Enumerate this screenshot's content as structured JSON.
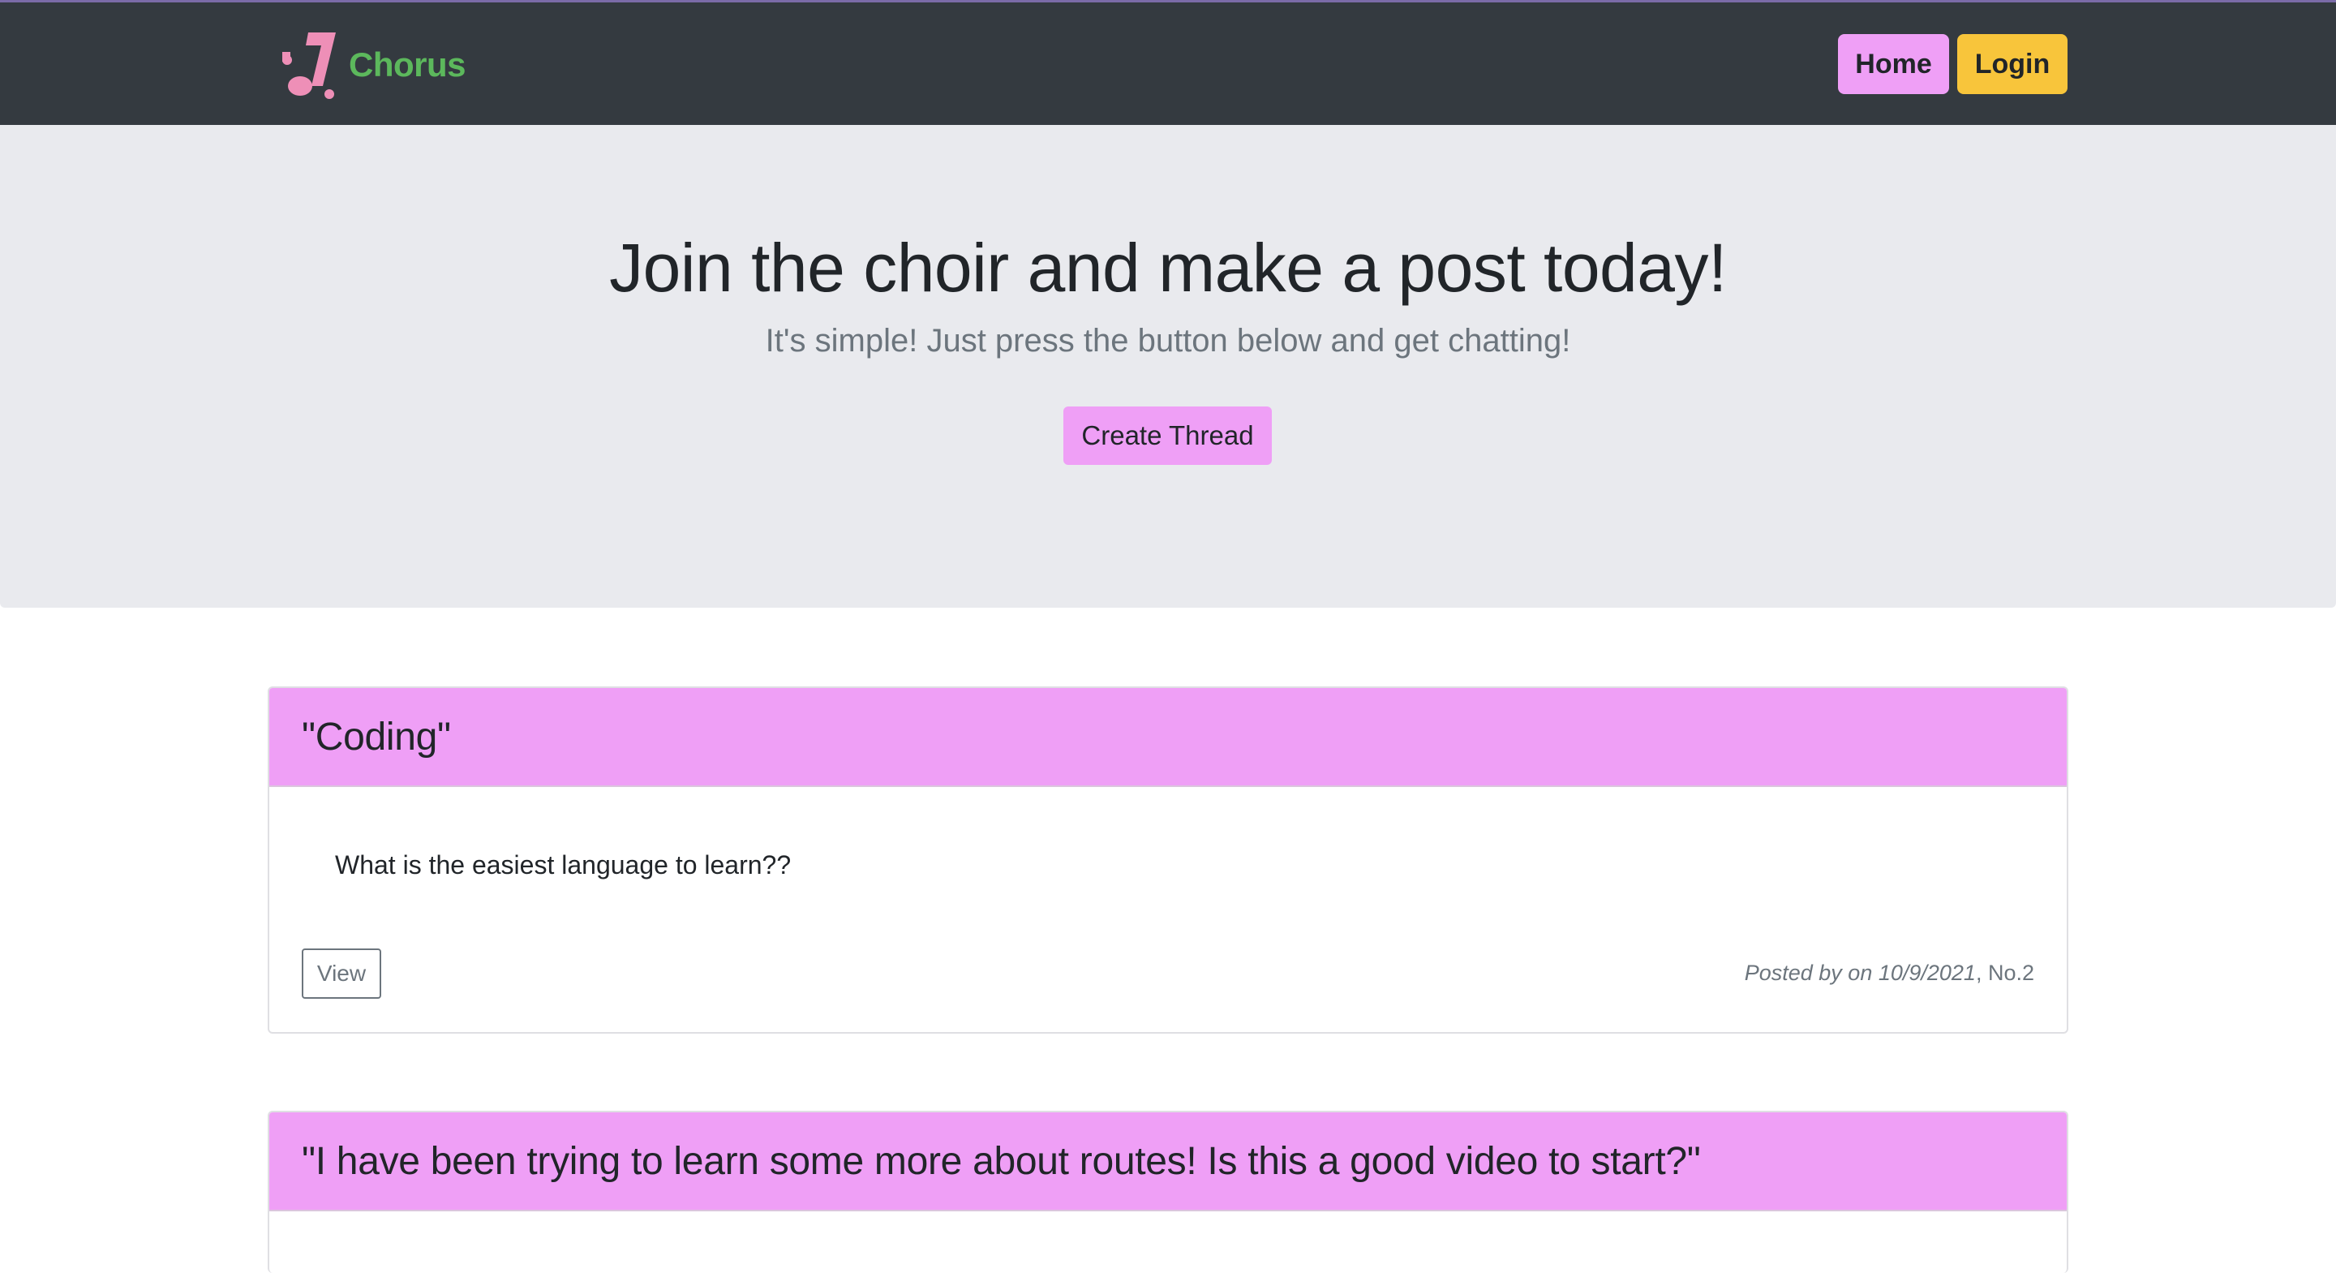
{
  "brand": {
    "name": "Chorus",
    "icon": "music-note-icon",
    "color": "#5cb85c"
  },
  "nav": {
    "home_label": "Home",
    "login_label": "Login"
  },
  "hero": {
    "title": "Join the choir and make a post today!",
    "subtitle": "It's simple! Just press the button below and get chatting!",
    "button_label": "Create Thread"
  },
  "threads": [
    {
      "title": "\"Coding\"",
      "body": "What is the easiest language to learn??",
      "view_label": "View",
      "meta_italic": "Posted by on 10/9/2021",
      "meta_suffix": ", No.2"
    },
    {
      "title": "\"I have been trying to learn some more about routes! Is this a good video to start?\""
    }
  ],
  "colors": {
    "navbar": "#343a40",
    "accent_pink": "#ef9ff6",
    "login_yellow": "#f8c53b",
    "hero_bg": "#e9eaee"
  }
}
